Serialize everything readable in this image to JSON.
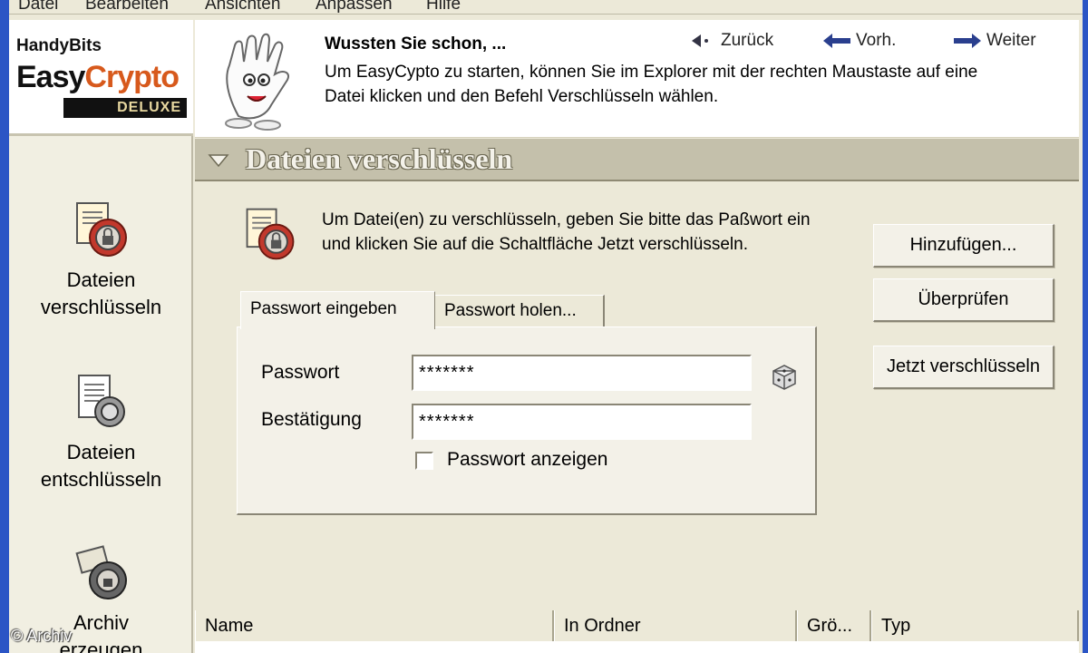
{
  "menubar": {
    "items": [
      "Datei",
      "Bearbeiten",
      "Ansichten",
      "Anpassen",
      "Hilfe"
    ]
  },
  "logo": {
    "brand": "HandyBits",
    "name_part1": "Easy",
    "name_part2": "Crypto",
    "edition": "DELUXE"
  },
  "sidebar": {
    "items": [
      {
        "label": "Dateien\nverschlüsseln"
      },
      {
        "label": "Dateien\nentschlüsseln"
      },
      {
        "label": "Archiv\nerzeugen"
      }
    ]
  },
  "tip": {
    "title": "Wussten Sie schon, ...",
    "text": "Um EasyCypto zu starten, können Sie im Explorer mit der rechten Maustaste auf eine Datei klicken und den Befehl Verschlüsseln wählen.",
    "back_label": "Zurück",
    "prev_label": "Vorh.",
    "next_label": "Weiter"
  },
  "section": {
    "title": "Dateien verschlüsseln"
  },
  "content": {
    "intro": "Um Datei(en) zu verschlüsseln, geben Sie bitte das Paßwort ein und klicken Sie auf die Schaltfläche Jetzt verschlüsseln.",
    "buttons": {
      "add": "Hinzufügen...",
      "check": "Überprüfen",
      "encrypt_now": "Jetzt verschlüsseln"
    },
    "tabs": {
      "enter_password": "Passwort eingeben",
      "fetch_password": "Passwort holen..."
    },
    "password_label": "Passwort",
    "confirm_label": "Bestätigung",
    "password_value": "*******",
    "confirm_value": "*******",
    "show_password_label": "Passwort anzeigen",
    "show_password_checked": false
  },
  "file_list": {
    "columns": [
      "Name",
      "In Ordner",
      "Grö...",
      "Typ"
    ]
  },
  "copyright": "© Archiv",
  "colors": {
    "frame": "#2b55c5",
    "background": "#ece9d8",
    "logo_accent": "#d7591c",
    "section_header": "#c4c0ab"
  }
}
